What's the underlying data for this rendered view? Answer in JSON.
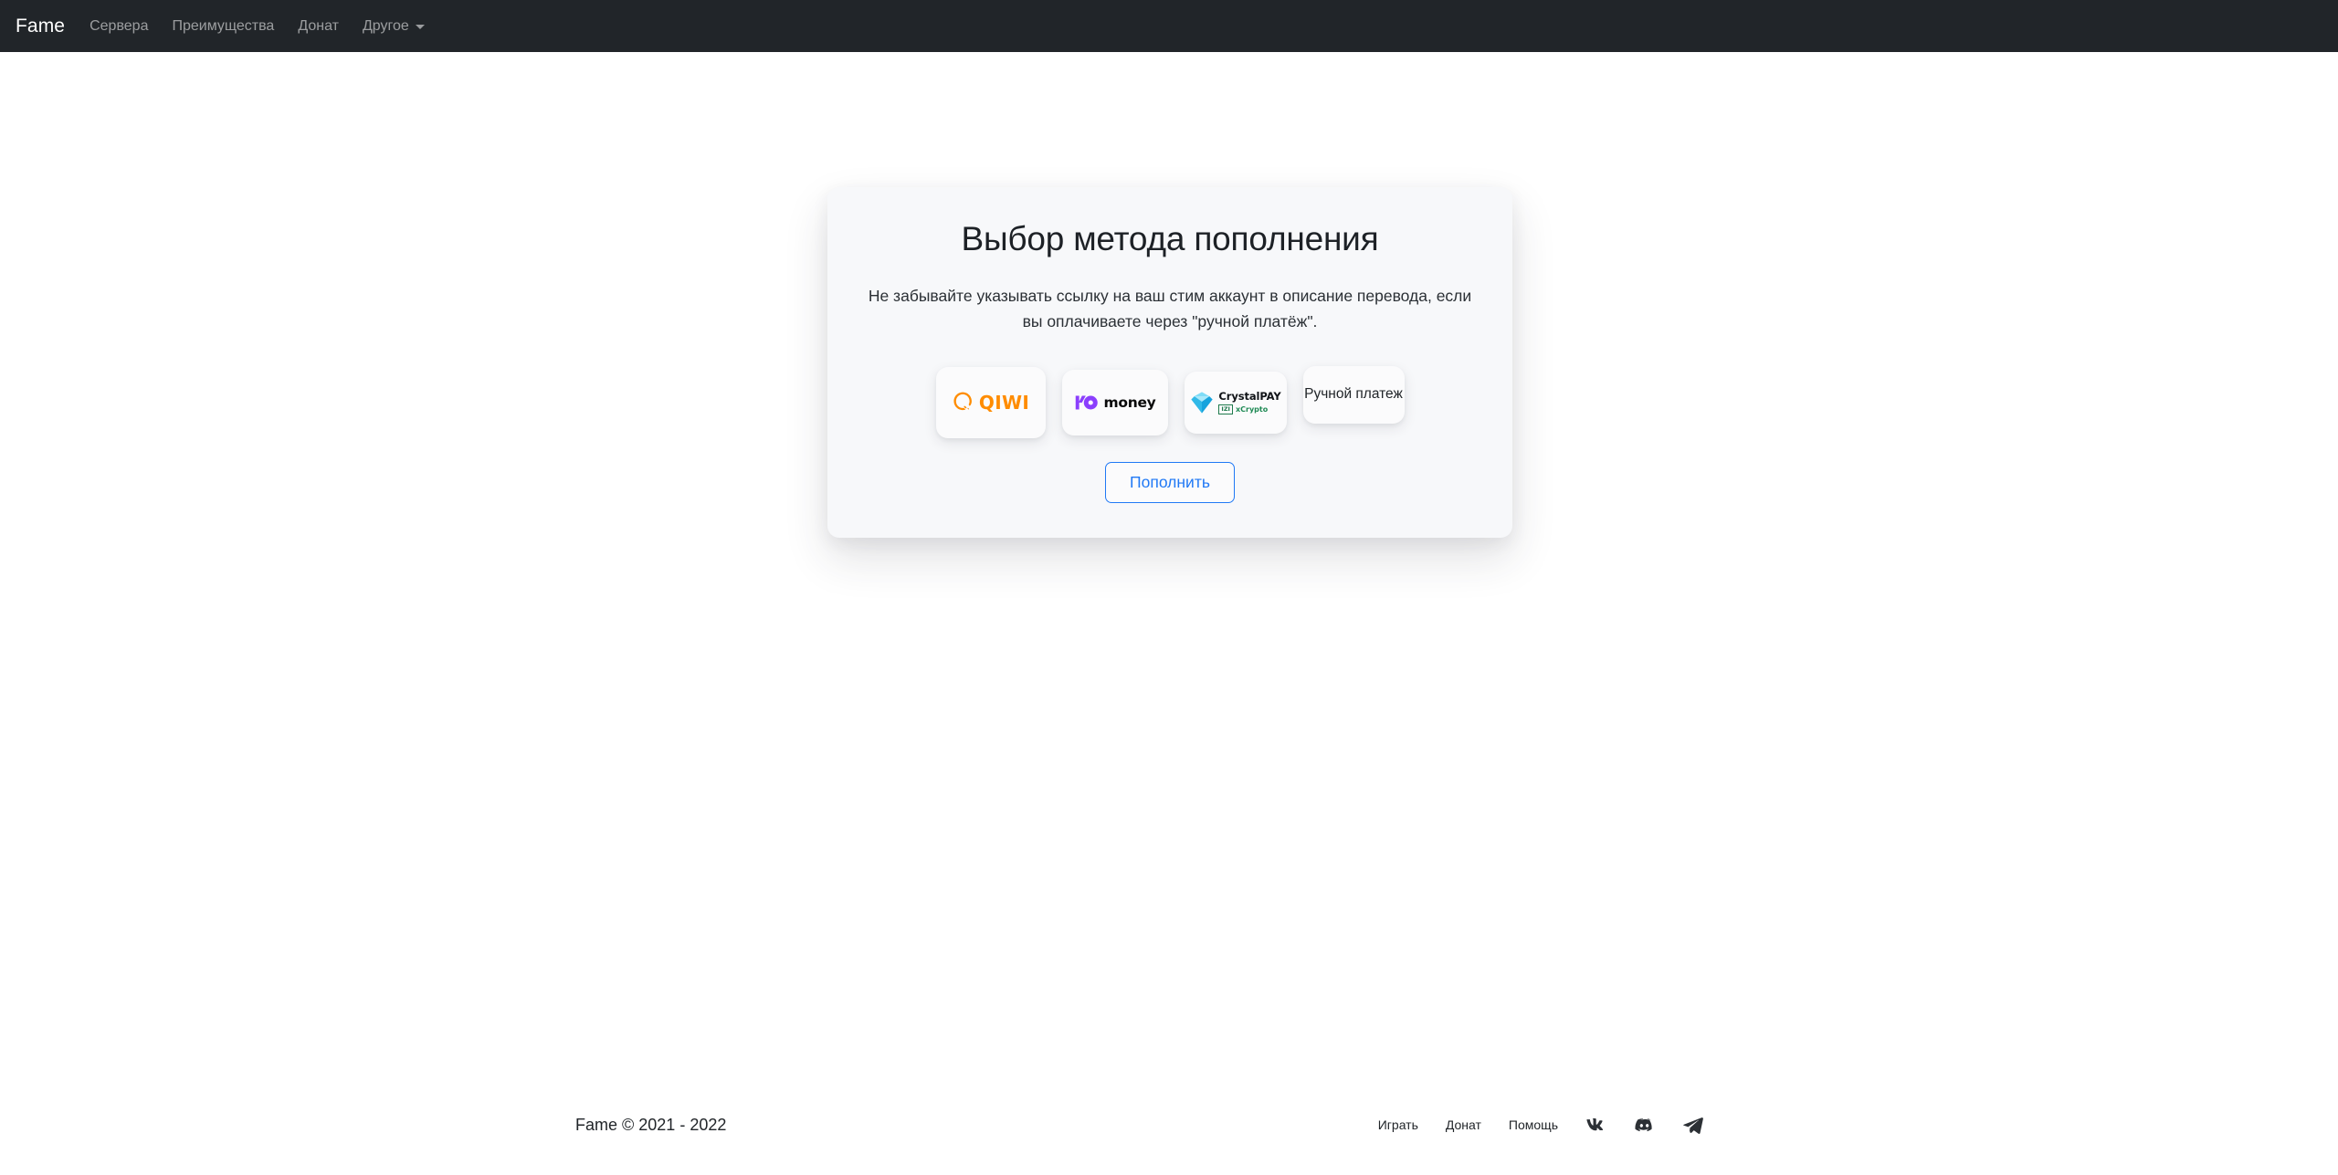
{
  "navbar": {
    "brand": "Fame",
    "links": [
      {
        "label": "Сервера",
        "icon": ""
      },
      {
        "label": "Преимущества",
        "icon": ""
      },
      {
        "label": "Донат",
        "icon": ""
      },
      {
        "label": "Другое",
        "icon": "chevron-down-icon"
      }
    ],
    "background_color": "#212529"
  },
  "card": {
    "title": "Выбор метода пополнения",
    "subtitle": "Не забывайте указывать ссылку на ваш стим аккаунт в описание перевода, если вы оплачиваете через \"ручной платёж\".",
    "background_color": "#f7f8fa",
    "methods": [
      {
        "id": "qiwi",
        "name": "QIWI",
        "logo_text": "QIWI",
        "icon": "qiwi-logo-icon",
        "color": "#ff8c00"
      },
      {
        "id": "yoomoney",
        "name": "ЮMoney",
        "logo_text": "money",
        "icon": "yoomoney-logo-icon",
        "color": "#8b3ffd"
      },
      {
        "id": "crystalpay",
        "name": "CrystalPAY",
        "logo_text": "CrystalPAY",
        "badge_text": "IZI",
        "sub_text": "xCrypto",
        "icon": "crystal-diamond-icon",
        "color": "#42c8f5"
      },
      {
        "id": "manual",
        "name": "Ручной платеж",
        "logo_text": "Ручной платеж",
        "icon": "",
        "color": "#212529"
      }
    ],
    "submit_label": "Пополнить",
    "submit_color": "#2079f5"
  },
  "footer": {
    "copyright": "Fame © 2021 - 2022",
    "links": [
      {
        "label": "Играть"
      },
      {
        "label": "Донат"
      },
      {
        "label": "Помощь"
      }
    ],
    "socials": [
      {
        "name": "vk-icon"
      },
      {
        "name": "discord-icon"
      },
      {
        "name": "telegram-icon"
      }
    ]
  }
}
